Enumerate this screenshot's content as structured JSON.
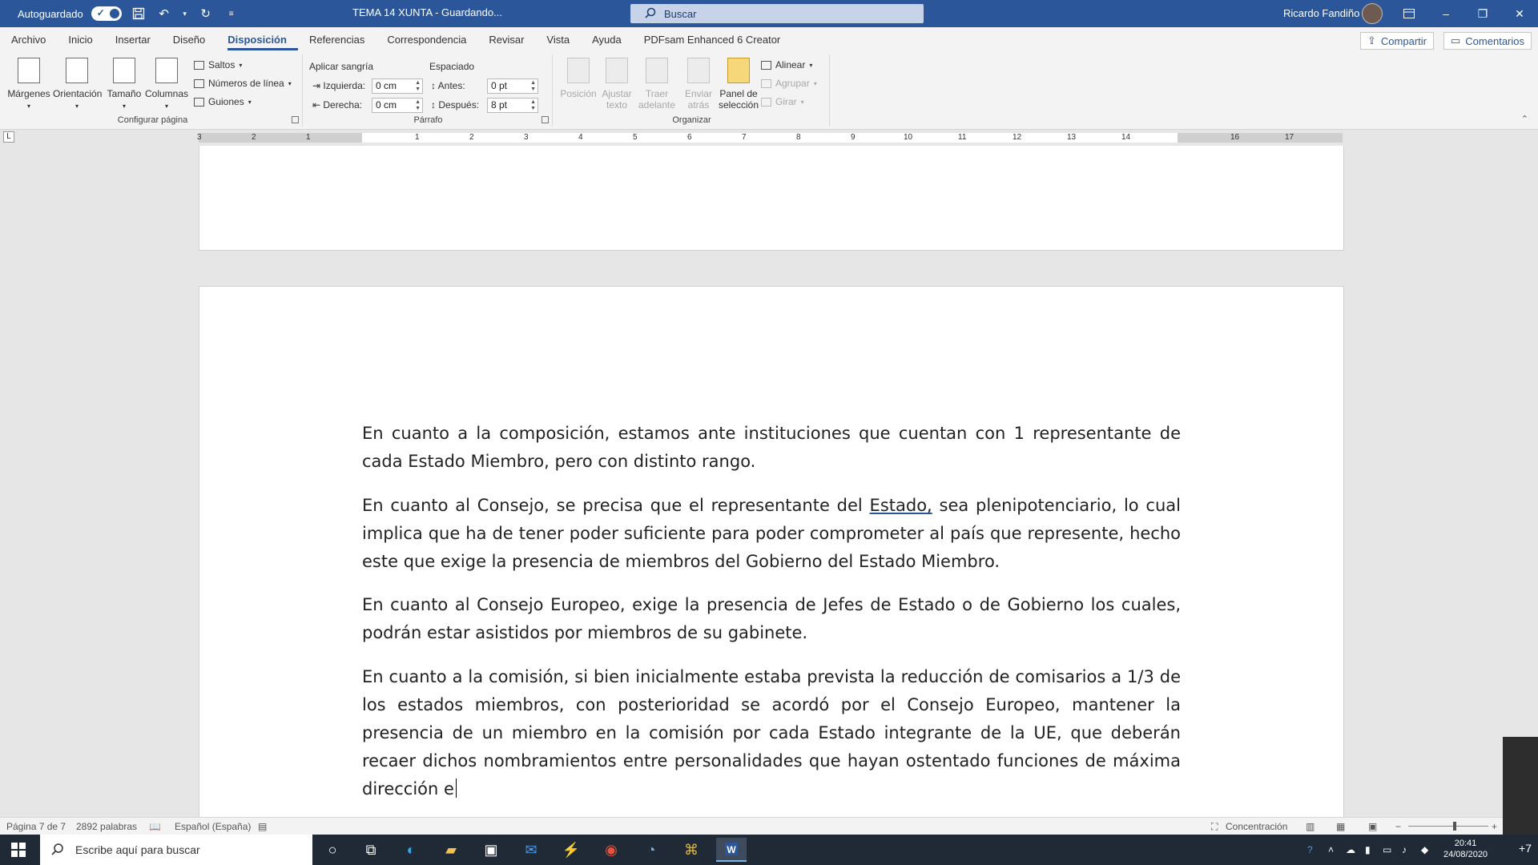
{
  "titlebar": {
    "autosave_label": "Autoguardado",
    "doc_title": "TEMA 14 XUNTA - Guardando...",
    "search_placeholder": "Buscar",
    "user_name": "Ricardo Fandiño"
  },
  "ribbon_tabs": [
    "Archivo",
    "Inicio",
    "Insertar",
    "Diseño",
    "Disposición",
    "Referencias",
    "Correspondencia",
    "Revisar",
    "Vista",
    "Ayuda",
    "PDFsam Enhanced 6 Creator"
  ],
  "active_tab": "Disposición",
  "share_label": "Compartir",
  "comments_label": "Comentarios",
  "ribbon": {
    "page_setup": {
      "label": "Configurar página",
      "margins": "Márgenes",
      "orientation": "Orientación",
      "size": "Tamaño",
      "columns": "Columnas",
      "breaks": "Saltos",
      "line_numbers": "Números de línea",
      "hyphenation": "Guiones"
    },
    "paragraph": {
      "label": "Párrafo",
      "indent_title": "Aplicar sangría",
      "spacing_title": "Espaciado",
      "left_label": "Izquierda:",
      "left_value": "0 cm",
      "right_label": "Derecha:",
      "right_value": "0 cm",
      "before_label": "Antes:",
      "before_value": "0 pt",
      "after_label": "Después:",
      "after_value": "8 pt"
    },
    "arrange": {
      "label": "Organizar",
      "position": "Posición",
      "wrap_text": "Ajustar texto",
      "bring_forward": "Traer adelante",
      "send_backward": "Enviar atrás",
      "selection_pane": "Panel de selección",
      "align": "Alinear",
      "group": "Agrupar",
      "rotate": "Girar"
    }
  },
  "ruler": {
    "corner": "L",
    "numbers": [
      "3",
      "2",
      "1",
      "1",
      "2",
      "3",
      "4",
      "5",
      "6",
      "7",
      "8",
      "9",
      "10",
      "11",
      "12",
      "13",
      "14",
      "16",
      "17"
    ]
  },
  "document": {
    "paragraphs": [
      "En cuanto a la composición, estamos ante instituciones que cuentan con 1 representante de cada Estado Miembro, pero con distinto rango.",
      "En cuanto al Consejo Europeo, exige la presencia de Jefes de Estado o de Gobierno los cuales, podrán estar asistidos por miembros de su gabinete.",
      "En cuanto a la comisión, si bien inicialmente estaba prevista la reducción de comisarios a 1/3 de los estados miembros, con posterioridad se acordó por el Consejo Europeo, mantener la presencia de un miembro en la comisión por cada Estado integrante de la UE, que deberán recaer dichos nombramientos entre personalidades que hayan ostentado funciones de máxima dirección e"
    ],
    "para2_before": "En cuanto al Consejo, se precisa que el representante del ",
    "para2_underlined": "Estado,",
    "para2_after": " sea plenipotenciario, lo cual implica que ha de tener poder suficiente para poder comprometer al país que represente, hecho este que exige la presencia de miembros del Gobierno del Estado Miembro."
  },
  "statusbar": {
    "page": "Página 7 de 7",
    "words": "2892 palabras",
    "language": "Español (España)",
    "focus": "Concentración"
  },
  "taskbar": {
    "search_placeholder": "Escribe aquí para buscar",
    "time": "20:41",
    "date": "24/08/2020",
    "badge": "+7"
  },
  "colors": {
    "word_blue": "#2b579a",
    "ribbon_bg": "#f3f3f3",
    "canvas_bg": "#e6e6e6",
    "taskbar_bg": "#1f2a36"
  }
}
